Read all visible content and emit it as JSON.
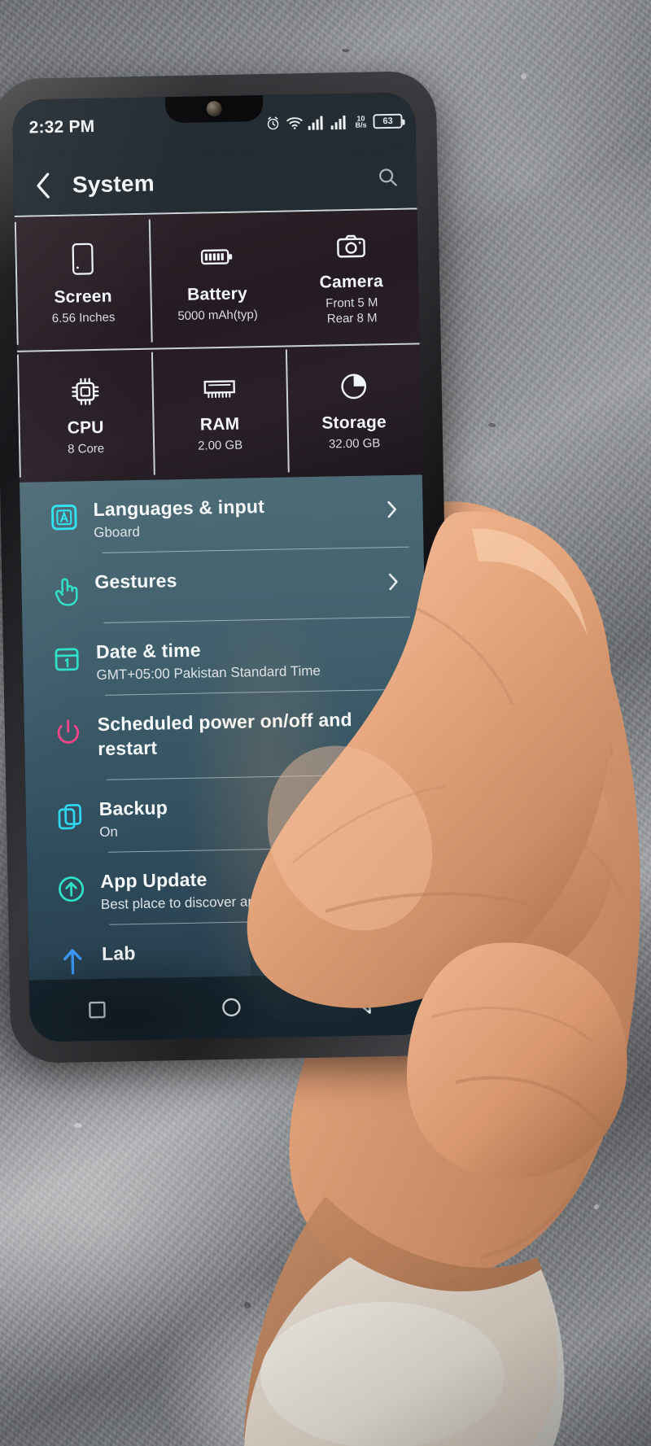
{
  "status_bar": {
    "time": "2:32 PM",
    "icons": [
      "alarm-icon",
      "wifi-icon",
      "signal-1-icon",
      "signal-2-icon"
    ],
    "data_rate_value": "10",
    "data_rate_unit": "B/s",
    "battery_percent": "63"
  },
  "app_bar": {
    "back_icon": "back-chevron-icon",
    "title": "System",
    "search_icon": "search-icon"
  },
  "spec_grid": [
    {
      "icon": "screen-icon",
      "title": "Screen",
      "value": "6.56 Inches",
      "value2": ""
    },
    {
      "icon": "battery-icon",
      "title": "Battery",
      "value": "5000 mAh(typ)",
      "value2": ""
    },
    {
      "icon": "camera-icon",
      "title": "Camera",
      "value": "Front 5 M",
      "value2": "Rear 8 M"
    },
    {
      "icon": "cpu-icon",
      "title": "CPU",
      "value": "8 Core",
      "value2": ""
    },
    {
      "icon": "ram-icon",
      "title": "RAM",
      "value": "2.00 GB",
      "value2": ""
    },
    {
      "icon": "storage-icon",
      "title": "Storage",
      "value": "32.00 GB",
      "value2": ""
    }
  ],
  "settings_items": [
    {
      "icon": "language-a-icon",
      "icon_color": "#2fe3f2",
      "title": "Languages & input",
      "subtitle": "Gboard",
      "arrow": true
    },
    {
      "icon": "gesture-hand-icon",
      "icon_color": "#2fe0c8",
      "title": "Gestures",
      "subtitle": "",
      "arrow": true
    },
    {
      "icon": "calendar-icon",
      "icon_color": "#2fe0c8",
      "title": "Date & time",
      "subtitle": "GMT+05:00 Pakistan Standard Time",
      "arrow": false
    },
    {
      "icon": "power-icon",
      "icon_color": "#f2468a",
      "title": "Scheduled power on/off and restart",
      "subtitle": "",
      "arrow": false
    },
    {
      "icon": "backup-copy-icon",
      "icon_color": "#2fd8f2",
      "title": "Backup",
      "subtitle": "On",
      "arrow": false
    },
    {
      "icon": "app-update-icon",
      "icon_color": "#2fe0c8",
      "title": "App Update",
      "subtitle": "Best place to discover apps",
      "arrow": true
    },
    {
      "icon": "lab-arrow-icon",
      "icon_color": "#3b9bff",
      "title": "Lab",
      "subtitle": "",
      "arrow": true
    }
  ],
  "nav_bar": {
    "recents_label": "recents-square-icon",
    "home_label": "home-circle-icon",
    "back_label": "back-triangle-icon"
  },
  "colors": {
    "status_bar_bg": "#232c33",
    "spec_grid_bg": "#281f26",
    "list_bg": "#3d5d6b",
    "accent_cyan": "#2fe3f2",
    "accent_pink": "#f2468a",
    "accent_blue": "#3b9bff"
  }
}
